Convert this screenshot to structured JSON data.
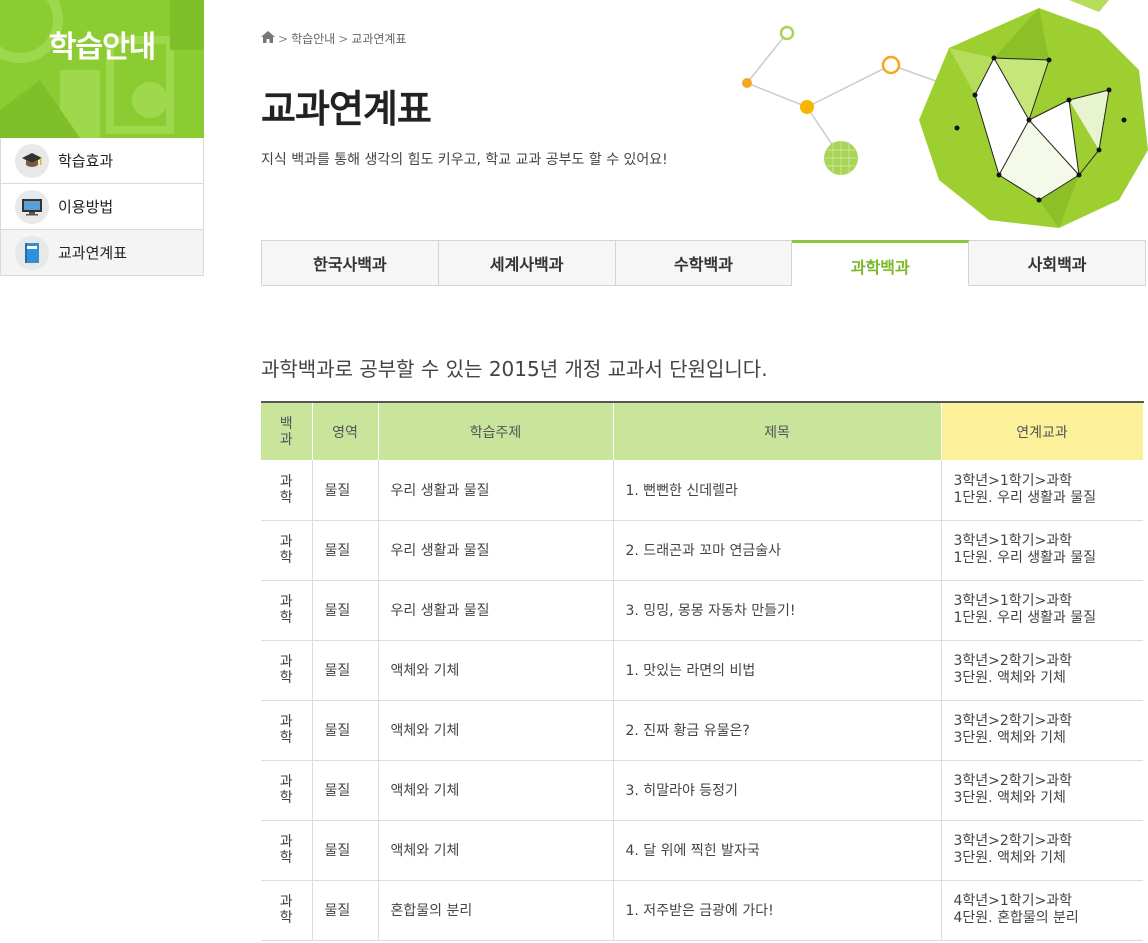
{
  "sidebar": {
    "banner_title": "학습안내",
    "items": [
      {
        "label": "학습효과",
        "icon": "graduation-cap-icon"
      },
      {
        "label": "이용방법",
        "icon": "monitor-icon"
      },
      {
        "label": "교과연계표",
        "icon": "book-icon"
      }
    ]
  },
  "breadcrumb": {
    "home_icon": "home-icon",
    "items": [
      "학습안내",
      "교과연계표"
    ]
  },
  "header": {
    "title": "교과연계표",
    "description": "지식 백과를 통해 생각의 힘도 키우고, 학교 교과 공부도 할 수 있어요!"
  },
  "tabs": [
    {
      "label": "한국사백과",
      "active": false
    },
    {
      "label": "세계사백과",
      "active": false
    },
    {
      "label": "수학백과",
      "active": false
    },
    {
      "label": "과학백과",
      "active": true
    },
    {
      "label": "사회백과",
      "active": false
    }
  ],
  "intro": "과학백과로 공부할 수 있는 2015년 개정 교과서 단원입니다.",
  "table": {
    "headers": {
      "encyclopedia": "백\n과",
      "area": "영역",
      "topic": "학습주제",
      "title": "제목",
      "linked": "연계교과"
    },
    "rows": [
      {
        "enc": "과\n학",
        "area": "물질",
        "topic": "우리 생활과 물질",
        "title": "1. 뻔뻔한 신데렐라",
        "linked1": "3학년>1학기>과학",
        "linked2": "1단원. 우리 생활과 물질"
      },
      {
        "enc": "과\n학",
        "area": "물질",
        "topic": "우리 생활과 물질",
        "title": "2. 드래곤과 꼬마 연금술사",
        "linked1": "3학년>1학기>과학",
        "linked2": "1단원. 우리 생활과 물질"
      },
      {
        "enc": "과\n학",
        "area": "물질",
        "topic": "우리 생활과 물질",
        "title": "3. 밍밍, 몽몽 자동차 만들기!",
        "linked1": "3학년>1학기>과학",
        "linked2": "1단원. 우리 생활과 물질"
      },
      {
        "enc": "과\n학",
        "area": "물질",
        "topic": "액체와 기체",
        "title": "1. 맛있는 라면의 비법",
        "linked1": "3학년>2학기>과학",
        "linked2": "3단원. 액체와 기체"
      },
      {
        "enc": "과\n학",
        "area": "물질",
        "topic": "액체와 기체",
        "title": "2. 진짜 황금 유물은?",
        "linked1": "3학년>2학기>과학",
        "linked2": "3단원. 액체와 기체"
      },
      {
        "enc": "과\n학",
        "area": "물질",
        "topic": "액체와 기체",
        "title": "3. 히말라야 등정기",
        "linked1": "3학년>2학기>과학",
        "linked2": "3단원. 액체와 기체"
      },
      {
        "enc": "과\n학",
        "area": "물질",
        "topic": "액체와 기체",
        "title": "4. 달 위에 찍힌 발자국",
        "linked1": "3학년>2학기>과학",
        "linked2": "3단원. 액체와 기체"
      },
      {
        "enc": "과\n학",
        "area": "물질",
        "topic": "혼합물의 분리",
        "title": "1. 저주받은 금광에 가다!",
        "linked1": "4학년>1학기>과학",
        "linked2": "4단원. 혼합물의 분리"
      }
    ]
  },
  "colors": {
    "accent_green": "#8cc63f",
    "header_green": "#c9e59c",
    "header_yellow": "#fdf09b",
    "active_tab_text": "#7bb82a"
  }
}
